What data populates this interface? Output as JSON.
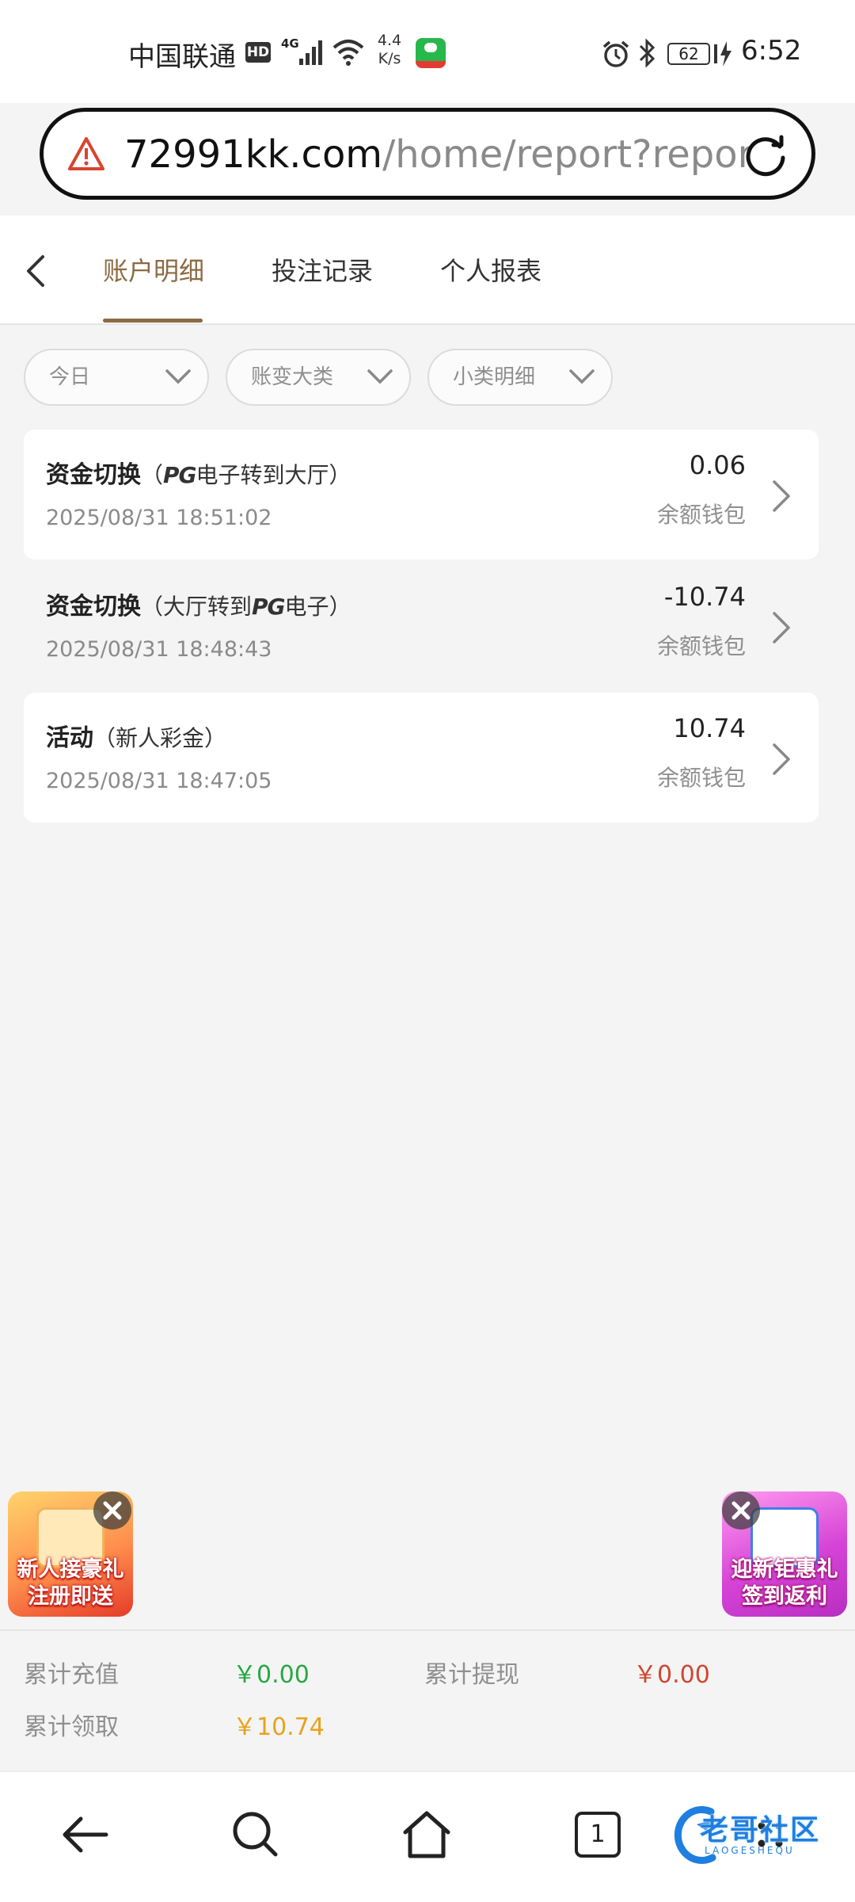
{
  "status_bar": {
    "carrier": "中国联通",
    "hd": "HD",
    "network": "4G",
    "speed_value": "4.4",
    "speed_unit": "K/s",
    "battery": "62",
    "time": "6:52"
  },
  "browser": {
    "url_domain": "72991kk.com",
    "url_path": "/home/report?report"
  },
  "tabs": [
    {
      "label": "账户明细",
      "active": true
    },
    {
      "label": "投注记录",
      "active": false
    },
    {
      "label": "个人报表",
      "active": false
    }
  ],
  "filters": [
    {
      "label": "今日"
    },
    {
      "label": "账变大类"
    },
    {
      "label": "小类明细"
    }
  ],
  "records": [
    {
      "type": "资金切换",
      "detail_open": "（",
      "detail_a": "",
      "detail_logo": "PG",
      "detail_b": "电子转到大厅",
      "detail_close": "）",
      "time": "2025/08/31 18:51:02",
      "amount": "0.06",
      "wallet": "余额钱包"
    },
    {
      "type": "资金切换",
      "detail_open": "（",
      "detail_a": "大厅转到",
      "detail_logo": "PG",
      "detail_b": "电子",
      "detail_close": "）",
      "time": "2025/08/31 18:48:43",
      "amount": "-10.74",
      "wallet": "余额钱包"
    },
    {
      "type": "活动",
      "detail_open": "（",
      "detail_a": "新人彩金",
      "detail_logo": "",
      "detail_b": "",
      "detail_close": "）",
      "time": "2025/08/31 18:47:05",
      "amount": "10.74",
      "wallet": "余额钱包"
    }
  ],
  "promos": {
    "left": {
      "line1": "新人接豪礼",
      "line2": "注册即送"
    },
    "right": {
      "line1": "迎新钜惠礼",
      "line2": "签到返利"
    }
  },
  "summary": {
    "deposit_label": "累计充值",
    "deposit_value": "￥0.00",
    "withdraw_label": "累计提现",
    "withdraw_value": "￥0.00",
    "claim_label": "累计领取",
    "claim_value": "￥10.74"
  },
  "colors": {
    "accent": "#8c6b43",
    "deposit": "#28a745",
    "withdraw": "#d0462f",
    "claim": "#e8a31c"
  },
  "bottom_nav": {
    "tab_count": "1",
    "watermark_text": "老哥社区",
    "watermark_sub": "LAOGESHEQU"
  }
}
